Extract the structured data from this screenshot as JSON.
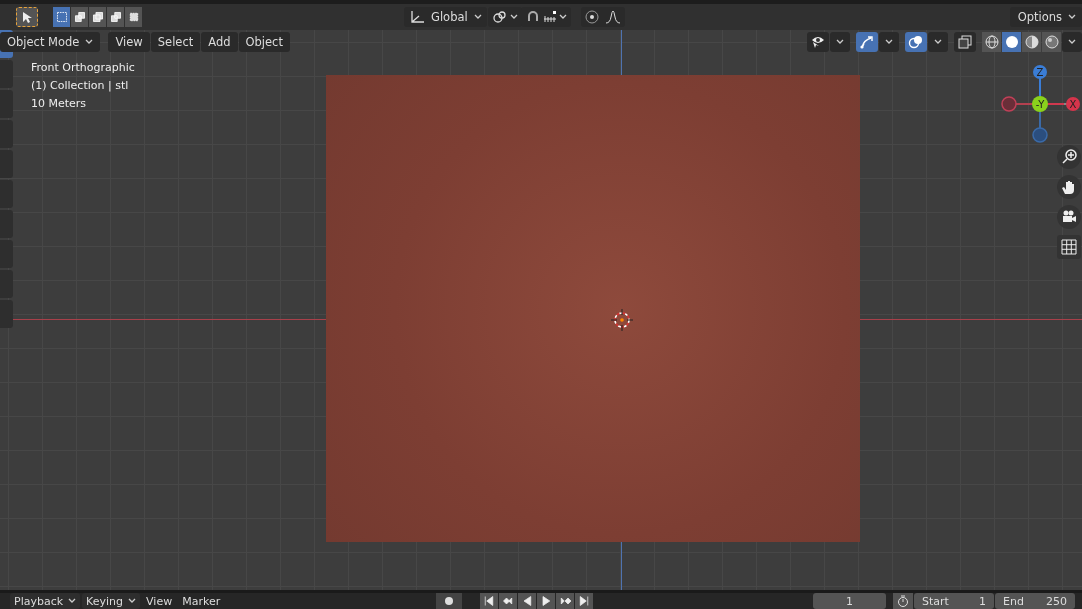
{
  "header": {
    "select_modes": [
      {
        "selected": true
      },
      {
        "selected": false
      },
      {
        "selected": false
      },
      {
        "selected": false
      },
      {
        "selected": false
      }
    ],
    "orientation": "Global",
    "proportional_edit": {
      "on": false
    },
    "options": "Options"
  },
  "viewport_header": {
    "mode": "Object Mode",
    "menus": [
      "View",
      "Select",
      "Add",
      "Object"
    ],
    "toggles": [
      {
        "kind": "visibility",
        "selected": false
      },
      {
        "kind": "gizmo",
        "selected": true
      },
      {
        "kind": "overlay",
        "selected": true
      },
      {
        "kind": "xray",
        "selected": false
      }
    ],
    "shading": [
      {
        "kind": "wireframe",
        "selected": false
      },
      {
        "kind": "solid",
        "selected": true
      },
      {
        "kind": "material",
        "selected": false
      },
      {
        "kind": "rendered",
        "selected": false
      }
    ]
  },
  "overlay_text": [
    "Front Orthographic",
    "(1) Collection | stl",
    "10 Meters"
  ],
  "gizmo": {
    "z": "Z",
    "y": "-Y",
    "x": "X"
  },
  "timeline": {
    "menus": [
      {
        "label": "Playback",
        "dropdown": true
      },
      {
        "label": "Keying",
        "dropdown": true
      },
      {
        "label": "View",
        "dropdown": false
      },
      {
        "label": "Marker",
        "dropdown": false
      }
    ],
    "current_frame": "1",
    "start_label": "Start",
    "start": "1",
    "end_label": "End",
    "end": "250"
  }
}
